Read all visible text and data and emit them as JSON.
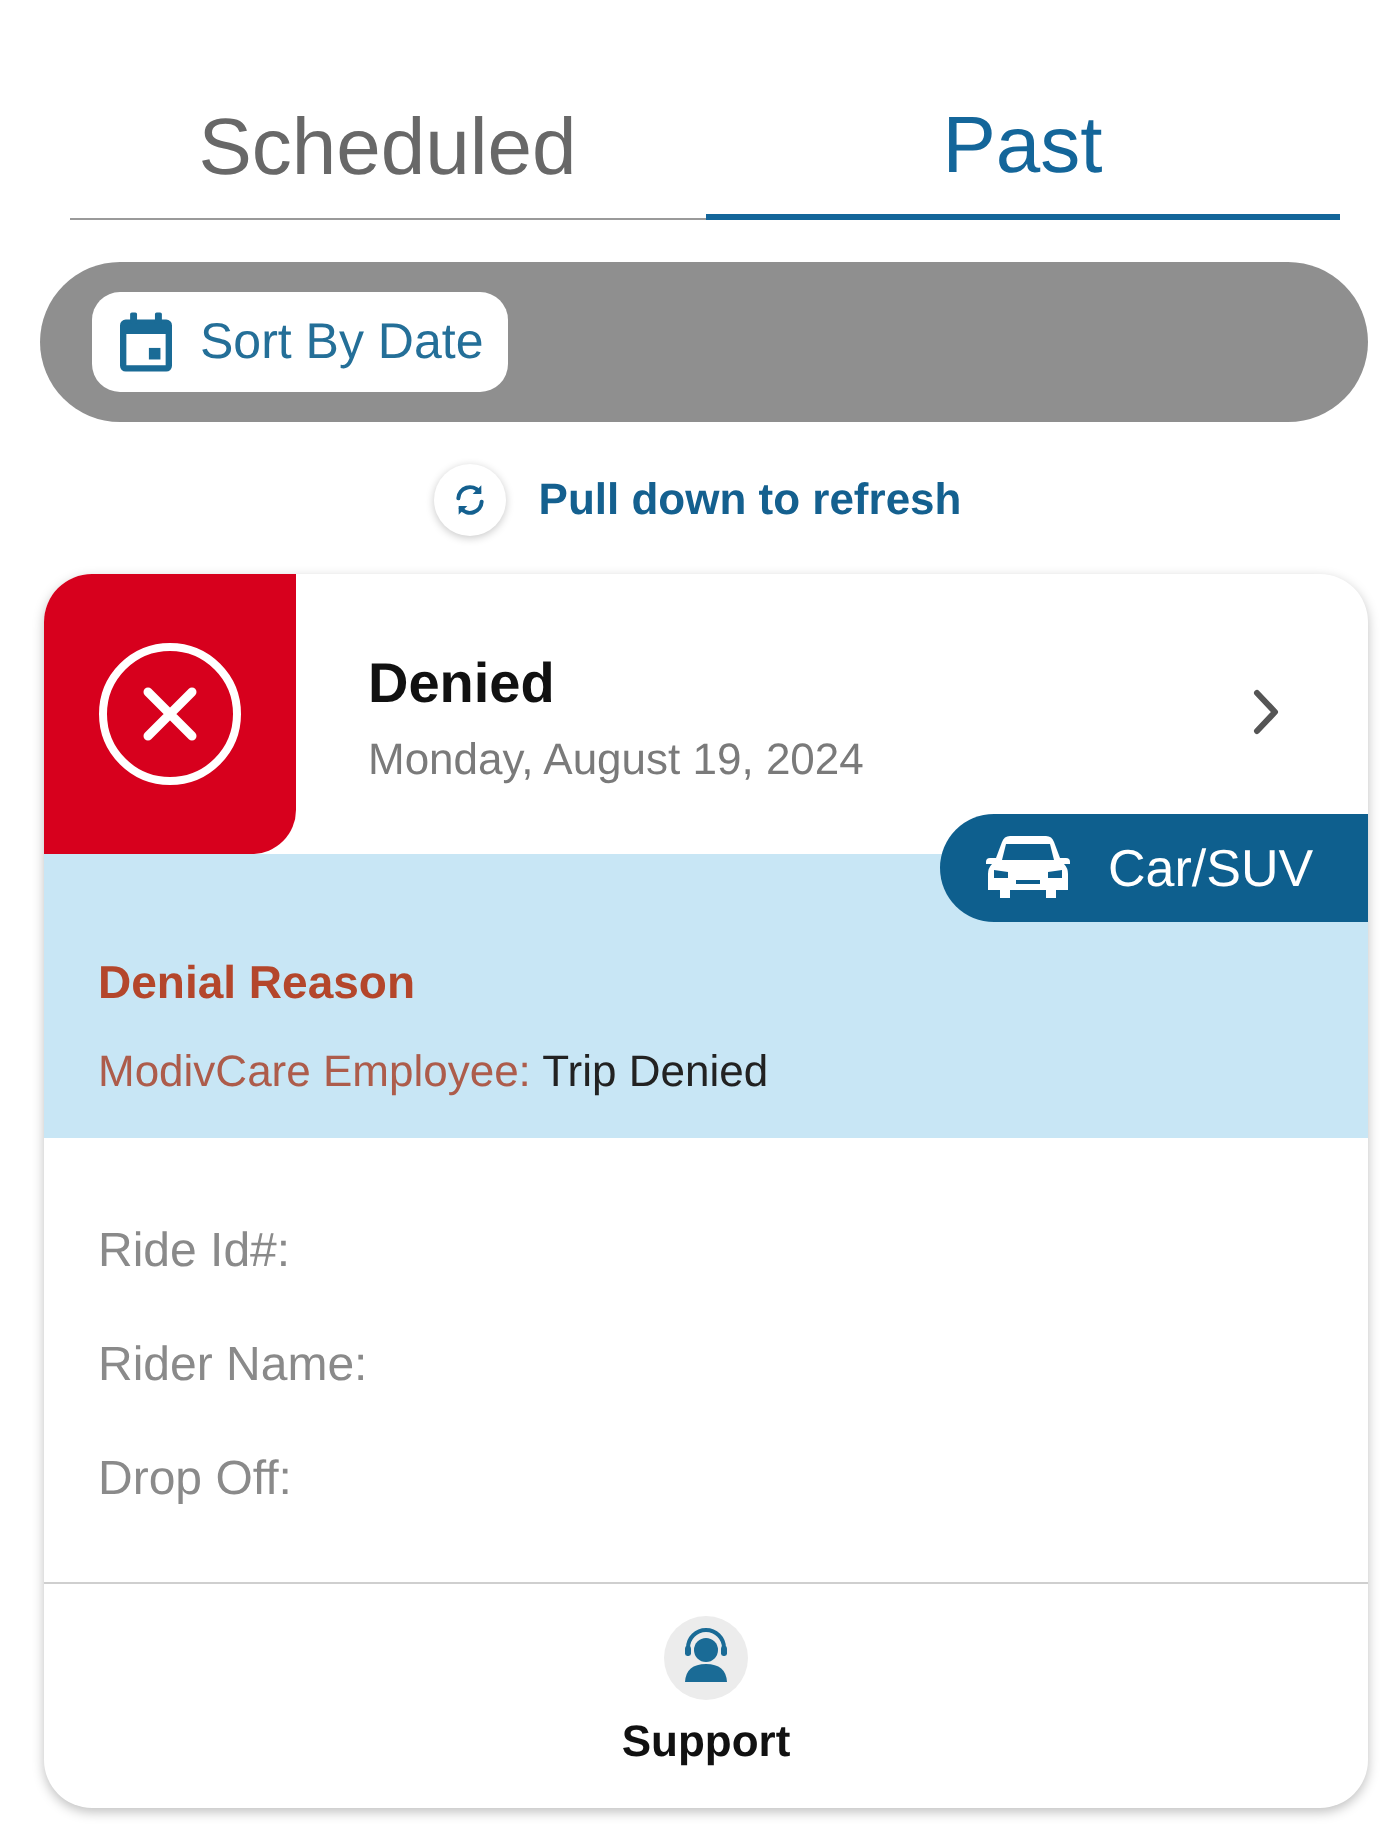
{
  "tabs": [
    {
      "label": "Scheduled",
      "selected": false
    },
    {
      "label": "Past",
      "selected": true
    }
  ],
  "sort_bar": {
    "button": "Sort By Date"
  },
  "refresh_hint": "Pull down to refresh",
  "trips": [
    {
      "kind": "denied",
      "status": "Denied",
      "date": "Monday, August 19, 2024",
      "vehicle": "Car/SUV",
      "reason": {
        "title": "Denial Reason",
        "source": "ModivCare Employee:",
        "text": "Trip Denied"
      },
      "fields": [
        "Ride Id#:",
        "Rider Name:",
        "Drop Off:"
      ],
      "action": "Support"
    }
  ]
}
